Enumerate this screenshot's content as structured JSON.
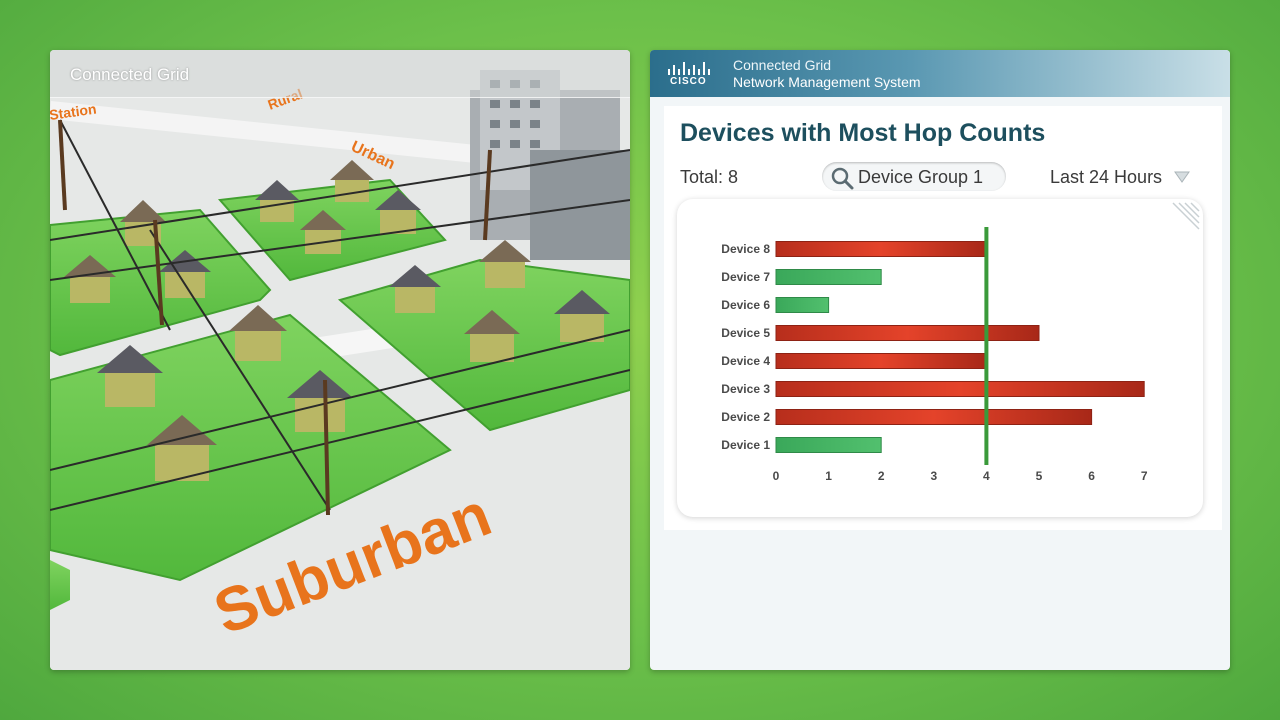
{
  "left_panel": {
    "title": "Connected Grid",
    "signs": {
      "station": "Station",
      "rural": "Rural",
      "urban": "Urban",
      "suburban": "Suburban"
    }
  },
  "right_panel": {
    "brand": "CISCO",
    "app_line1": "Connected Grid",
    "app_line2": "Network Management System",
    "chart_title": "Devices with Most Hop Counts",
    "total_label": "Total: 8",
    "device_group": "Device Group 1",
    "time_range": "Last 24 Hours"
  },
  "colors": {
    "over": "#d43a22",
    "under": "#3aa85a",
    "threshold": "#3a9a3a",
    "title": "#1d4f5e"
  },
  "icons": [
    "search-icon",
    "chevron-down-icon",
    "cisco-logo-icon"
  ],
  "chart_data": {
    "type": "bar",
    "orientation": "horizontal",
    "title": "Devices with Most Hop Counts",
    "categories": [
      "Device 8",
      "Device 7",
      "Device 6",
      "Device 5",
      "Device 4",
      "Device 3",
      "Device 2",
      "Device 1"
    ],
    "values": [
      4,
      2,
      1,
      5,
      4,
      7,
      6,
      2
    ],
    "xlim": [
      0,
      7
    ],
    "xticks": [
      "0",
      "1",
      "2",
      "3",
      "4",
      "5",
      "6",
      "7"
    ],
    "threshold": 4,
    "grid": false
  }
}
